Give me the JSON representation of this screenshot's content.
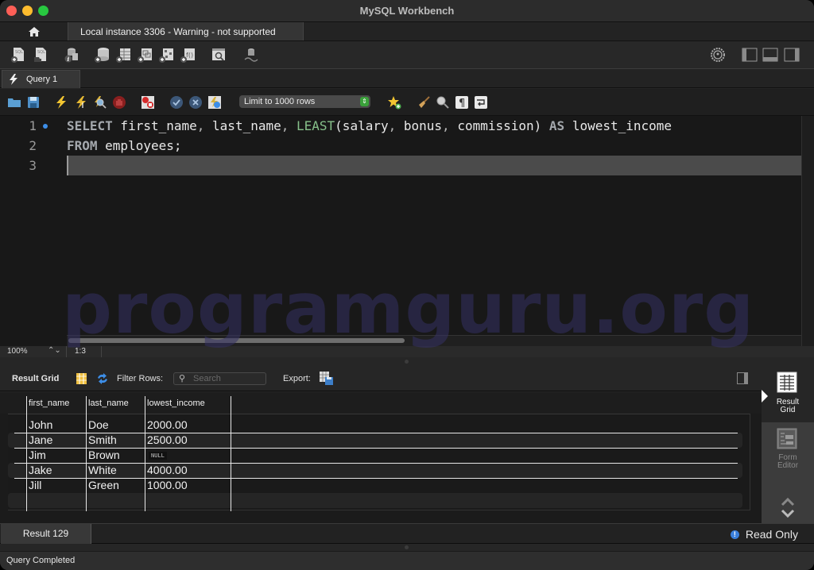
{
  "window": {
    "title": "MySQL Workbench"
  },
  "connection_tabs": {
    "home_icon": "home-icon",
    "active_tab": "Local instance 3306 - Warning - not supported"
  },
  "main_toolbar": {
    "left_icons": [
      "new-sql-tab-icon",
      "open-sql-script-icon",
      "schema-inspector-icon",
      "create-schema-icon",
      "create-table-icon",
      "create-view-icon",
      "create-procedure-icon",
      "create-function-icon",
      "search-table-data-icon",
      "reconnect-icon"
    ],
    "right_icons": [
      "settings-gear-icon",
      "toggle-sidebar-icon",
      "toggle-output-panel-icon",
      "toggle-secondary-sidebar-icon"
    ]
  },
  "query_tabs": [
    {
      "label": "Query 1",
      "icon": "lightning-icon",
      "active": true
    }
  ],
  "sql_toolbar": {
    "icons": [
      "open-file-icon",
      "save-icon",
      "execute-icon",
      "execute-current-icon",
      "explain-icon",
      "stop-icon",
      "toggle-error-stop-icon",
      "commit-icon",
      "rollback-icon",
      "autocommit-icon"
    ],
    "limit_select": "Limit to 1000 rows",
    "right_icons": [
      "add-snippet-icon",
      "beautify-icon",
      "find-icon",
      "invisible-chars-icon",
      "wrap-lines-icon"
    ]
  },
  "editor": {
    "lines": [
      {
        "number": "1",
        "text": "SELECT first_name, last_name, LEAST(salary, bonus, commission) AS lowest_income",
        "has_marker": true
      },
      {
        "number": "2",
        "text": "FROM employees;",
        "has_marker": false
      },
      {
        "number": "3",
        "text": "",
        "has_marker": false
      }
    ],
    "tokens": {
      "line1": {
        "kw1": "SELECT",
        "t1": " first_name",
        "p1": ",",
        "t2": " last_name",
        "p2": ",",
        "fn": " LEAST",
        "t3": "(salary",
        "p3": ",",
        "t4": " bonus",
        "p4": ",",
        "t5": " commission)",
        "kw2": " AS",
        "t6": " lowest_income"
      },
      "line2": {
        "kw1": "FROM",
        "t1": " employees;"
      }
    },
    "zoom": "100%",
    "cursor_position": "1:3"
  },
  "watermark": "programguru.org",
  "result_toolbar": {
    "result_grid_label": "Result Grid",
    "filter_label": "Filter Rows:",
    "search_placeholder": "Search",
    "export_label": "Export:"
  },
  "result_grid": {
    "columns": [
      "first_name",
      "last_name",
      "lowest_income"
    ],
    "rows": [
      [
        "John",
        "Doe",
        "2000.00"
      ],
      [
        "Jane",
        "Smith",
        "2500.00"
      ],
      [
        "Jim",
        "Brown",
        "NULL"
      ],
      [
        "Jake",
        "White",
        "4000.00"
      ],
      [
        "Jill",
        "Green",
        "1000.00"
      ]
    ]
  },
  "side_panel": {
    "items": [
      {
        "label_line1": "Result",
        "label_line2": "Grid",
        "active": true
      },
      {
        "label_line1": "Form",
        "label_line2": "Editor",
        "active": false
      }
    ]
  },
  "result_tabs": {
    "active_tab": "Result 129",
    "read_only": "Read Only"
  },
  "status_bar": {
    "text": "Query Completed"
  }
}
